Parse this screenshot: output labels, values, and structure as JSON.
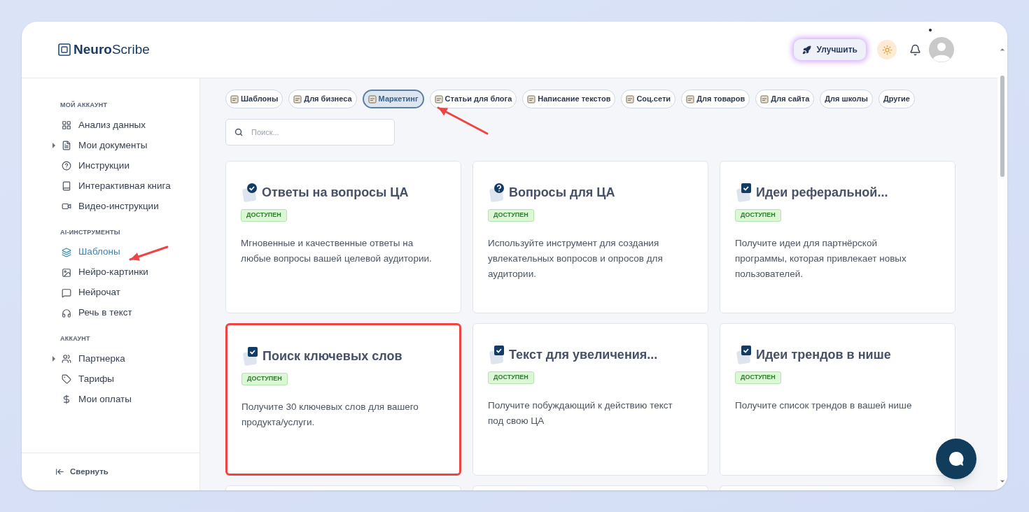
{
  "logo": {
    "bold": "Neuro",
    "rest": "Scribe"
  },
  "header": {
    "upgrade_label": "Улучшить",
    "notification_dot": true
  },
  "sidebar": {
    "sections": [
      {
        "title": "МОЙ АККАУНТ",
        "items": [
          {
            "label": "Анализ данных",
            "kind": "grid",
            "has_caret": false,
            "selected": false
          },
          {
            "label": "Мои документы",
            "kind": "document",
            "has_caret": true,
            "selected": false
          },
          {
            "label": "Инструкции",
            "kind": "help",
            "has_caret": false,
            "selected": false
          },
          {
            "label": "Интерактивная книга",
            "kind": "book",
            "has_caret": false,
            "selected": false
          },
          {
            "label": "Видео-инструкции",
            "kind": "video",
            "has_caret": false,
            "selected": false
          }
        ]
      },
      {
        "title": "AI-ИНСТРУМЕНТЫ",
        "items": [
          {
            "label": "Шаблоны",
            "kind": "layers",
            "has_caret": false,
            "selected": true
          },
          {
            "label": "Нейро-картинки",
            "kind": "image",
            "has_caret": false,
            "selected": false
          },
          {
            "label": "Нейрочат",
            "kind": "chat",
            "has_caret": false,
            "selected": false
          },
          {
            "label": "Речь в текст",
            "kind": "headphones",
            "has_caret": false,
            "selected": false
          }
        ]
      },
      {
        "title": "АККАУНТ",
        "items": [
          {
            "label": "Партнерка",
            "kind": "users",
            "has_caret": true,
            "selected": false
          },
          {
            "label": "Тарифы",
            "kind": "tag",
            "has_caret": false,
            "selected": false
          },
          {
            "label": "Мои оплаты",
            "kind": "dollar",
            "has_caret": false,
            "selected": false
          }
        ]
      }
    ],
    "collapse_label": "Свернуть"
  },
  "categories": [
    {
      "label": "Шаблоны",
      "has_icon": true,
      "selected": false
    },
    {
      "label": "Для бизнеса",
      "has_icon": true,
      "selected": false
    },
    {
      "label": "Маркетинг",
      "has_icon": true,
      "selected": true
    },
    {
      "label": "Статьи для блога",
      "has_icon": true,
      "selected": false
    },
    {
      "label": "Написание текстов",
      "has_icon": true,
      "selected": false
    },
    {
      "label": "Соц.сети",
      "has_icon": true,
      "selected": false
    },
    {
      "label": "Для товаров",
      "has_icon": true,
      "selected": false
    },
    {
      "label": "Для сайта",
      "has_icon": true,
      "selected": false
    },
    {
      "label": "Для школы",
      "has_icon": false,
      "selected": false
    },
    {
      "label": "Другие",
      "has_icon": false,
      "selected": false
    }
  ],
  "search": {
    "placeholder": "Поиск..."
  },
  "cards": [
    {
      "title": "Ответы на вопросы ЦА",
      "kind": "check-circle",
      "badge": "ДОСТУПЕН",
      "description": "Мгновенные и качественные ответы на любые вопросы вашей целевой аудитории.",
      "highlighted": false
    },
    {
      "title": "Вопросы для ЦА",
      "kind": "question",
      "badge": "ДОСТУПЕН",
      "description": "Используйте инструмент для создания увлекательных вопросов и опросов для аудитории.",
      "highlighted": false
    },
    {
      "title": "Идеи реферальной...",
      "kind": "checkbox",
      "badge": "ДОСТУПЕН",
      "description": "Получите идеи для партнёрской программы, которая привлекает новых пользователей.",
      "highlighted": false
    },
    {
      "title": "Поиск ключевых слов",
      "kind": "checkbox",
      "badge": "ДОСТУПЕН",
      "description": "Получите 30 ключевых слов для вашего продукта/услуги.",
      "highlighted": true
    },
    {
      "title": "Текст для увеличения...",
      "kind": "checkbox",
      "badge": "ДОСТУПЕН",
      "description": "Получите побуждающий к действию текст под свою ЦА",
      "highlighted": false
    },
    {
      "title": "Идеи трендов в нише",
      "kind": "checkbox",
      "badge": "ДОСТУПЕН",
      "description": "Получите список трендов в вашей нише",
      "highlighted": false
    }
  ]
}
